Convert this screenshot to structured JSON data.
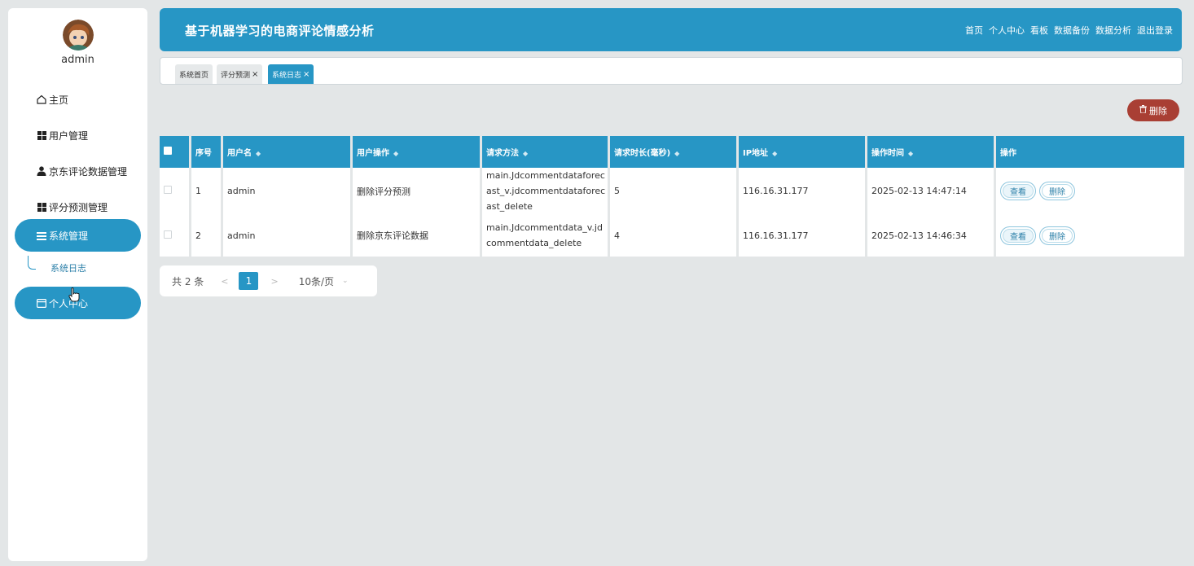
{
  "user": {
    "name": "admin"
  },
  "sidebar": {
    "items": [
      {
        "label": "主页",
        "icon": "home-icon"
      },
      {
        "label": "用户管理",
        "icon": "grid-icon"
      },
      {
        "label": "京东评论数据管理",
        "icon": "person-icon"
      },
      {
        "label": "评分预测管理",
        "icon": "grid-icon"
      },
      {
        "label": "系统管理",
        "icon": "list-icon",
        "active": true
      },
      {
        "label": "个人中心",
        "icon": "card-icon",
        "active": true
      }
    ],
    "submenu": {
      "label": "系统日志"
    }
  },
  "header": {
    "title": "基于机器学习的电商评论情感分析",
    "nav": [
      "首页",
      "个人中心",
      "看板",
      "数据备份",
      "数据分析",
      "退出登录"
    ]
  },
  "tabs": [
    {
      "label": "系统首页",
      "closable": false
    },
    {
      "label": "评分预测",
      "closable": true
    },
    {
      "label": "系统日志",
      "closable": true,
      "active": true
    }
  ],
  "toolbar": {
    "delete_label": "删除"
  },
  "table": {
    "headers": {
      "index": "序号",
      "username": "用户名",
      "operation": "用户操作",
      "method": "请求方法",
      "duration": "请求时长(毫秒)",
      "ip": "IP地址",
      "time": "操作时间",
      "actions": "操作"
    },
    "view_label": "查看",
    "delete_label": "删除",
    "rows": [
      {
        "index": "1",
        "username": "admin",
        "operation": "删除评分预测",
        "method": "main.Jdcommentdataforecast_v.jdcommentdataforecast_delete",
        "duration": "5",
        "ip": "116.16.31.177",
        "time": "2025-02-13 14:47:14"
      },
      {
        "index": "2",
        "username": "admin",
        "operation": "删除京东评论数据",
        "method": "main.Jdcommentdata_v.jdcommentdata_delete",
        "duration": "4",
        "ip": "116.16.31.177",
        "time": "2025-02-13 14:46:34"
      }
    ]
  },
  "pagination": {
    "total_label": "共 2 条",
    "current_page": "1",
    "page_size_label": "10条/页",
    "prev": "<",
    "next": ">"
  },
  "colors": {
    "primary": "#2796c5",
    "danger": "#a93f34",
    "background": "#e3e6e7"
  }
}
